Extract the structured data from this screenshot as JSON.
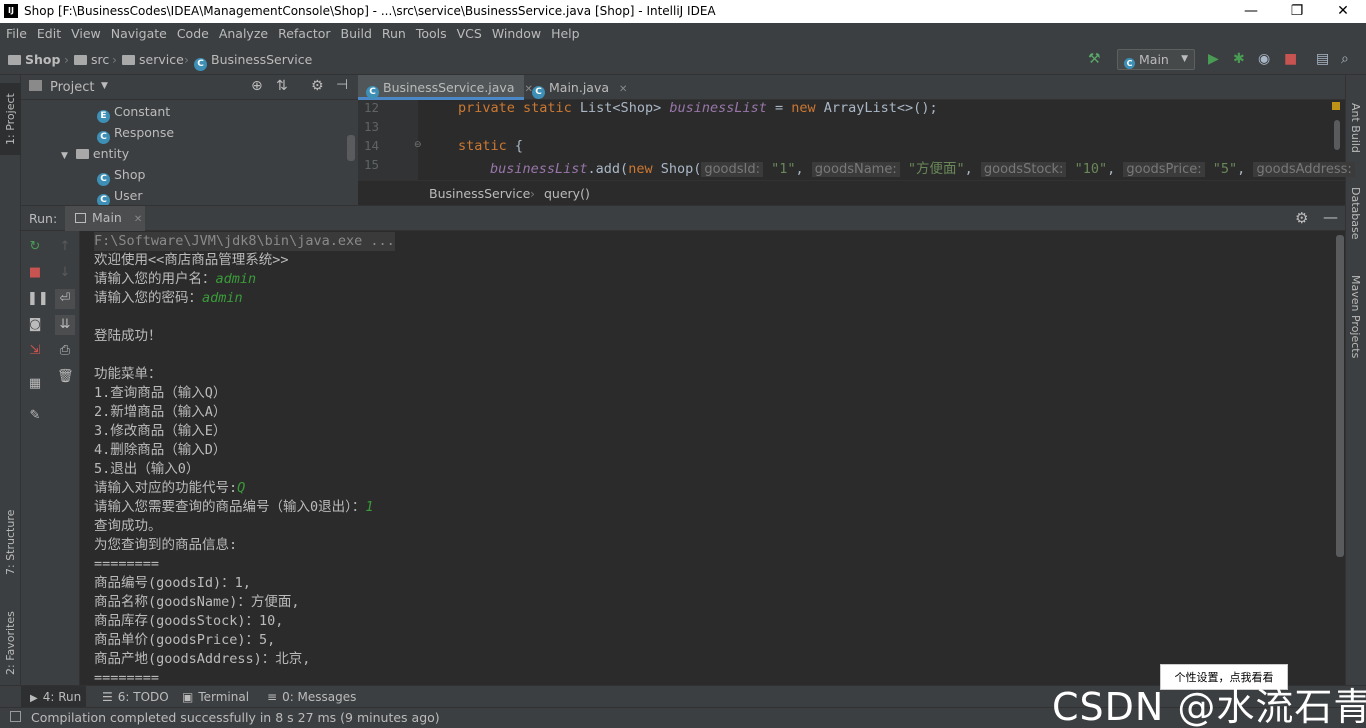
{
  "window": {
    "title": "Shop [F:\\BusinessCodes\\IDEA\\ManagementConsole\\Shop] - ...\\src\\service\\BusinessService.java [Shop] - IntelliJ IDEA",
    "logo": "IJ",
    "minimize": "—",
    "restore": "❐",
    "close": "✕"
  },
  "menu": [
    "File",
    "Edit",
    "View",
    "Navigate",
    "Code",
    "Analyze",
    "Refactor",
    "Build",
    "Run",
    "Tools",
    "VCS",
    "Window",
    "Help"
  ],
  "breadcrumb": {
    "project": "Shop",
    "src": "src",
    "service": "service",
    "file": "BusinessService"
  },
  "toolbar": {
    "run_config": "Main",
    "colors": {
      "run": "#499c54",
      "stop": "#c75450",
      "build": "#59a869"
    }
  },
  "left_strip": {
    "project": "1: Project",
    "structure": "7: Structure",
    "favorites": "2: Favorites"
  },
  "right_strip": {
    "ant": "Ant Build",
    "database": "Database",
    "maven": "Maven Projects"
  },
  "project_panel": {
    "title": "Project",
    "items": [
      {
        "label": "Constant",
        "icon": "E"
      },
      {
        "label": "Response",
        "icon": "C"
      },
      {
        "label": "entity",
        "icon": "folder"
      },
      {
        "label": "Shop",
        "icon": "C"
      },
      {
        "label": "User",
        "icon": "C"
      }
    ]
  },
  "editor": {
    "tabs": [
      {
        "label": "BusinessService.java",
        "active": true
      },
      {
        "label": "Main.java",
        "active": false
      }
    ],
    "line_numbers": [
      "12",
      "13",
      "14",
      "15"
    ],
    "code": {
      "l12_kw1": "private static ",
      "l12_type": "List<Shop> ",
      "l12_field": "businessList",
      "l12_eq": " = ",
      "l12_new": "new ",
      "l12_rest": "ArrayList<>();",
      "l14_kw": "static",
      "l14_brace": " {",
      "l15_field": "businessList",
      "l15_add": ".add(",
      "l15_new": "new ",
      "l15_shop": "Shop(",
      "hint_id": "goodsId:",
      "val_id": "\"1\"",
      "hint_name": "goodsName:",
      "val_name": "\"方便面\"",
      "hint_stock": "goodsStock:",
      "val_stock": "\"10\"",
      "hint_price": "goodsPrice:",
      "val_price": "\"5\"",
      "hint_addr": "goodsAddress:"
    },
    "breadcrumb": {
      "cls": "BusinessService",
      "method": "query()"
    }
  },
  "run_panel": {
    "label": "Run:",
    "tab": "Main",
    "console": [
      {
        "text": "F:\\Software\\JVM\\jdk8\\bin\\java.exe ...",
        "input": ""
      },
      {
        "text": "欢迎使用<<商店商品管理系统>>",
        "input": ""
      },
      {
        "text": "请输入您的用户名：",
        "input": "admin"
      },
      {
        "text": "请输入您的密码：",
        "input": "admin"
      },
      {
        "text": "",
        "input": ""
      },
      {
        "text": "登陆成功！",
        "input": ""
      },
      {
        "text": "",
        "input": ""
      },
      {
        "text": "功能菜单：",
        "input": ""
      },
      {
        "text": "1.查询商品（输入Q）",
        "input": ""
      },
      {
        "text": "2.新增商品（输入A）",
        "input": ""
      },
      {
        "text": "3.修改商品（输入E）",
        "input": ""
      },
      {
        "text": "4.删除商品（输入D）",
        "input": ""
      },
      {
        "text": "5.退出（输入0）",
        "input": ""
      },
      {
        "text": "请输入对应的功能代号:",
        "input": "Q"
      },
      {
        "text": "请输入您需要查询的商品编号（输入0退出）：",
        "input": "1"
      },
      {
        "text": "查询成功。",
        "input": ""
      },
      {
        "text": "为您查询到的商品信息:",
        "input": ""
      },
      {
        "text": "========",
        "input": ""
      },
      {
        "text": "商品编号(goodsId)：1,",
        "input": ""
      },
      {
        "text": "商品名称(goodsName)：方便面,",
        "input": ""
      },
      {
        "text": "商品库存(goodsStock)：10,",
        "input": ""
      },
      {
        "text": "商品单价(goodsPrice)：5,",
        "input": ""
      },
      {
        "text": "商品产地(goodsAddress)：北京,",
        "input": ""
      },
      {
        "text": "========",
        "input": ""
      }
    ]
  },
  "bottom_tabs": [
    {
      "label": "4: Run",
      "icon": "▶"
    },
    {
      "label": "6: TODO",
      "icon": "☰"
    },
    {
      "label": "Terminal",
      "icon": "▣"
    },
    {
      "label": "0: Messages",
      "icon": "≡"
    }
  ],
  "status": "Compilation completed successfully in 8 s 27 ms (9 minutes ago)",
  "tooltip": "个性设置，点我看看",
  "watermark": "CSDN @水流石青"
}
